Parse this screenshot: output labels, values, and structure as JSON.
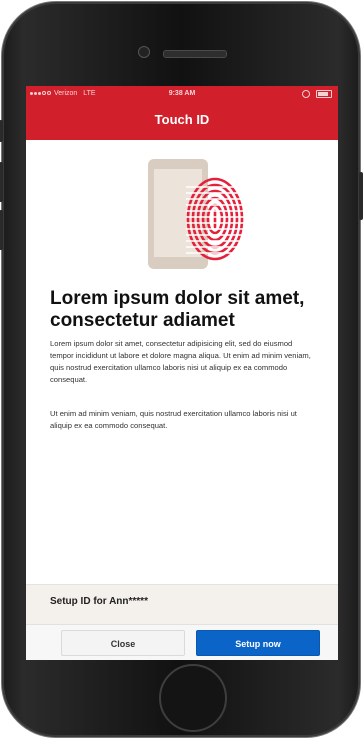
{
  "status_bar": {
    "carrier": "Verizon",
    "network": "LTE",
    "time": "9:38 AM"
  },
  "header": {
    "title": "Touch ID"
  },
  "main": {
    "headline": "Lorem ipsum dolor sit amet, consectetur adiamet",
    "paragraph1": "Lorem ipsum dolor sit amet, consectetur adipisicing elit, sed do eiusmod tempor incididunt ut labore et dolore magna aliqua. Ut enim ad minim veniam, quis nostrud exercitation ullamco laboris nisi ut aliquip ex ea commodo consequat.",
    "paragraph2": "Ut enim ad minim veniam, quis nostrud exercitation ullamco laboris nisi ut aliquip ex ea commodo consequat."
  },
  "setup": {
    "label": "Setup ID for Ann*****"
  },
  "buttons": {
    "close_label": "Close",
    "setup_label": "Setup now"
  },
  "colors": {
    "brand_red": "#d11f2b",
    "primary_blue": "#0b64c8",
    "fingerprint": "#e5203a",
    "phone_illustration": "#d9ccc1"
  },
  "icons": {
    "illustration": "phone-with-fingerprint-icon"
  }
}
